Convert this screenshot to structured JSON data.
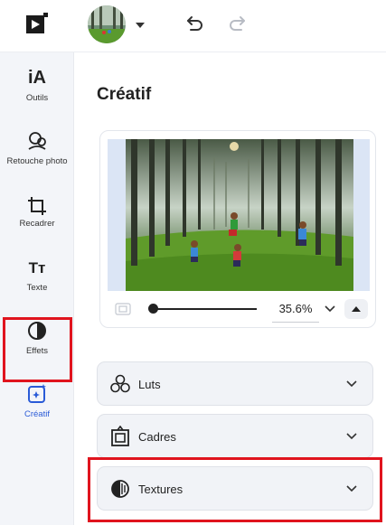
{
  "toolbar": {
    "logo_icon": "video-logo-icon",
    "avatar_icon": "user-avatar-photo",
    "undo_icon": "undo-icon",
    "redo_icon": "redo-icon"
  },
  "sidebar": {
    "items": [
      {
        "label": "Outils",
        "icon": "ai-tools-icon"
      },
      {
        "label": "Retouche photo",
        "icon": "photo-retouch-icon"
      },
      {
        "label": "Recadrer",
        "icon": "crop-icon"
      },
      {
        "label": "Texte",
        "icon": "text-icon"
      },
      {
        "label": "Effets",
        "icon": "effects-icon"
      },
      {
        "label": "Créatif",
        "icon": "creative-icon",
        "active": true
      }
    ],
    "ai_glyph": "iA",
    "text_glyph": "Tт"
  },
  "main": {
    "title": "Créatif",
    "preview": {
      "zoom_value": "35.6%",
      "zoom_fraction": 0.0
    },
    "accordions": [
      {
        "label": "Luts",
        "icon": "luts-icon"
      },
      {
        "label": "Cadres",
        "icon": "frames-icon"
      },
      {
        "label": "Textures",
        "icon": "textures-icon",
        "highlighted": true
      }
    ]
  },
  "colors": {
    "accent": "#2a5bd7",
    "highlight": "#e0141e",
    "sidebar_bg": "#f3f5f9",
    "preview_bg": "#dbe5f5"
  }
}
